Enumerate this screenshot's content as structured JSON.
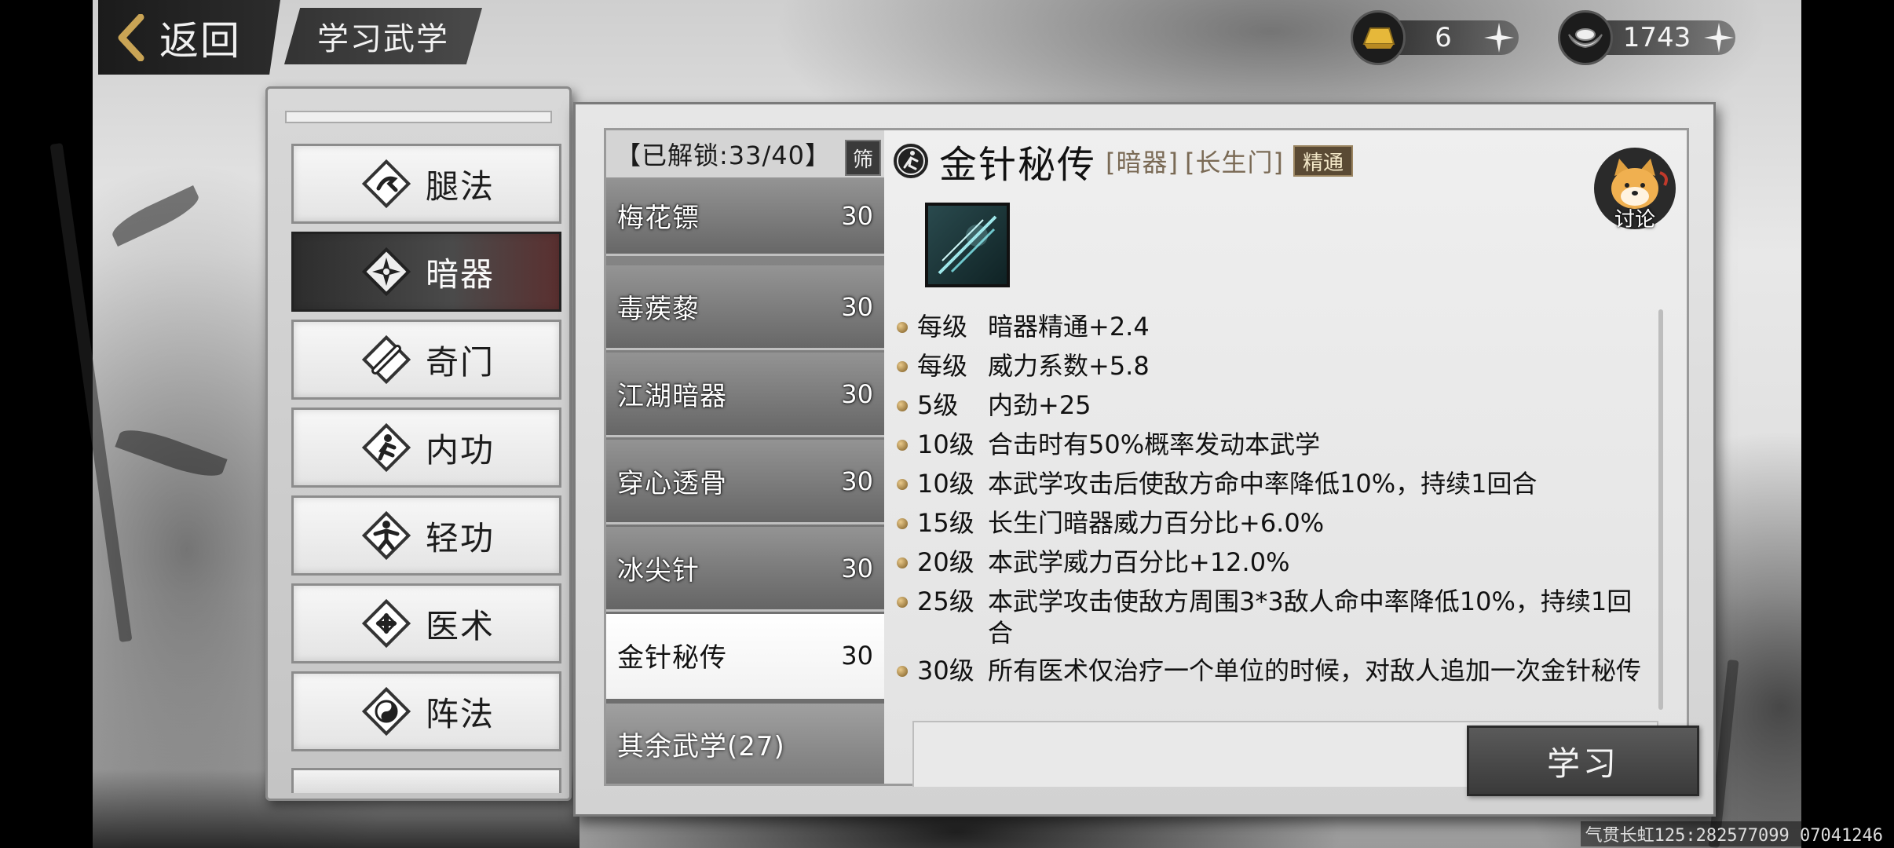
{
  "header": {
    "back_label": "返回",
    "title": "学习武学",
    "currencies": [
      {
        "name": "gold",
        "icon": "gold-ingot-icon",
        "value": "6"
      },
      {
        "name": "silver",
        "icon": "silver-ingot-icon",
        "value": "1743"
      }
    ]
  },
  "categories": [
    {
      "label": "腿法",
      "icon": "kick-icon",
      "active": false
    },
    {
      "label": "暗器",
      "icon": "shuriken-icon",
      "active": true
    },
    {
      "label": "奇门",
      "icon": "scroll-icon",
      "active": false
    },
    {
      "label": "内功",
      "icon": "meditation-icon",
      "active": false
    },
    {
      "label": "轻功",
      "icon": "leap-icon",
      "active": false
    },
    {
      "label": "医术",
      "icon": "medicine-icon",
      "active": false
    },
    {
      "label": "阵法",
      "icon": "yinyang-icon",
      "active": false
    }
  ],
  "skill_list": {
    "unlock_text": "【已解锁:33/40】",
    "filter_label": "筛",
    "items": [
      {
        "name": "梅花镖",
        "level": "30"
      },
      {
        "name": "毒蒺藜",
        "level": "30"
      },
      {
        "name": "江湖暗器",
        "level": "30"
      },
      {
        "name": "穿心透骨",
        "level": "30"
      },
      {
        "name": "冰尖针",
        "level": "30"
      },
      {
        "name": "金针秘传",
        "level": "30",
        "selected": true
      }
    ],
    "other_label": "其余武学(27)"
  },
  "detail": {
    "title": "金针秘传",
    "tag_type": "[暗器]",
    "tag_sect": "[长生门]",
    "mastery_badge": "精通",
    "discuss_label": "讨论",
    "effects": [
      {
        "level": "每级",
        "text": "暗器精通+2.4"
      },
      {
        "level": "每级",
        "text": "威力系数+5.8"
      },
      {
        "level": "5级",
        "text": "内劲+25"
      },
      {
        "level": "10级",
        "text": "合击时有50%概率发动本武学"
      },
      {
        "level": "10级",
        "text": "本武学攻击后使敌方命中率降低10%，持续1回合"
      },
      {
        "level": "15级",
        "text": "长生门暗器威力百分比+6.0%"
      },
      {
        "level": "20级",
        "text": "本武学威力百分比+12.0%"
      },
      {
        "level": "25级",
        "text": "本武学攻击使敌方周围3*3敌人命中率降低10%，持续1回合"
      },
      {
        "level": "30级",
        "text": "所有医术仅治疗一个单位的时候，对敌人追加一次金针秘传"
      }
    ],
    "learn_label": "学习"
  },
  "watermark": "气贯长虹125:282577099 07041246",
  "colors": {
    "selected_bg": "#ffffff",
    "active_category": "#2d2d2d",
    "mastery_badge": "#5a4a34",
    "tag_text": "#7a6a55"
  }
}
